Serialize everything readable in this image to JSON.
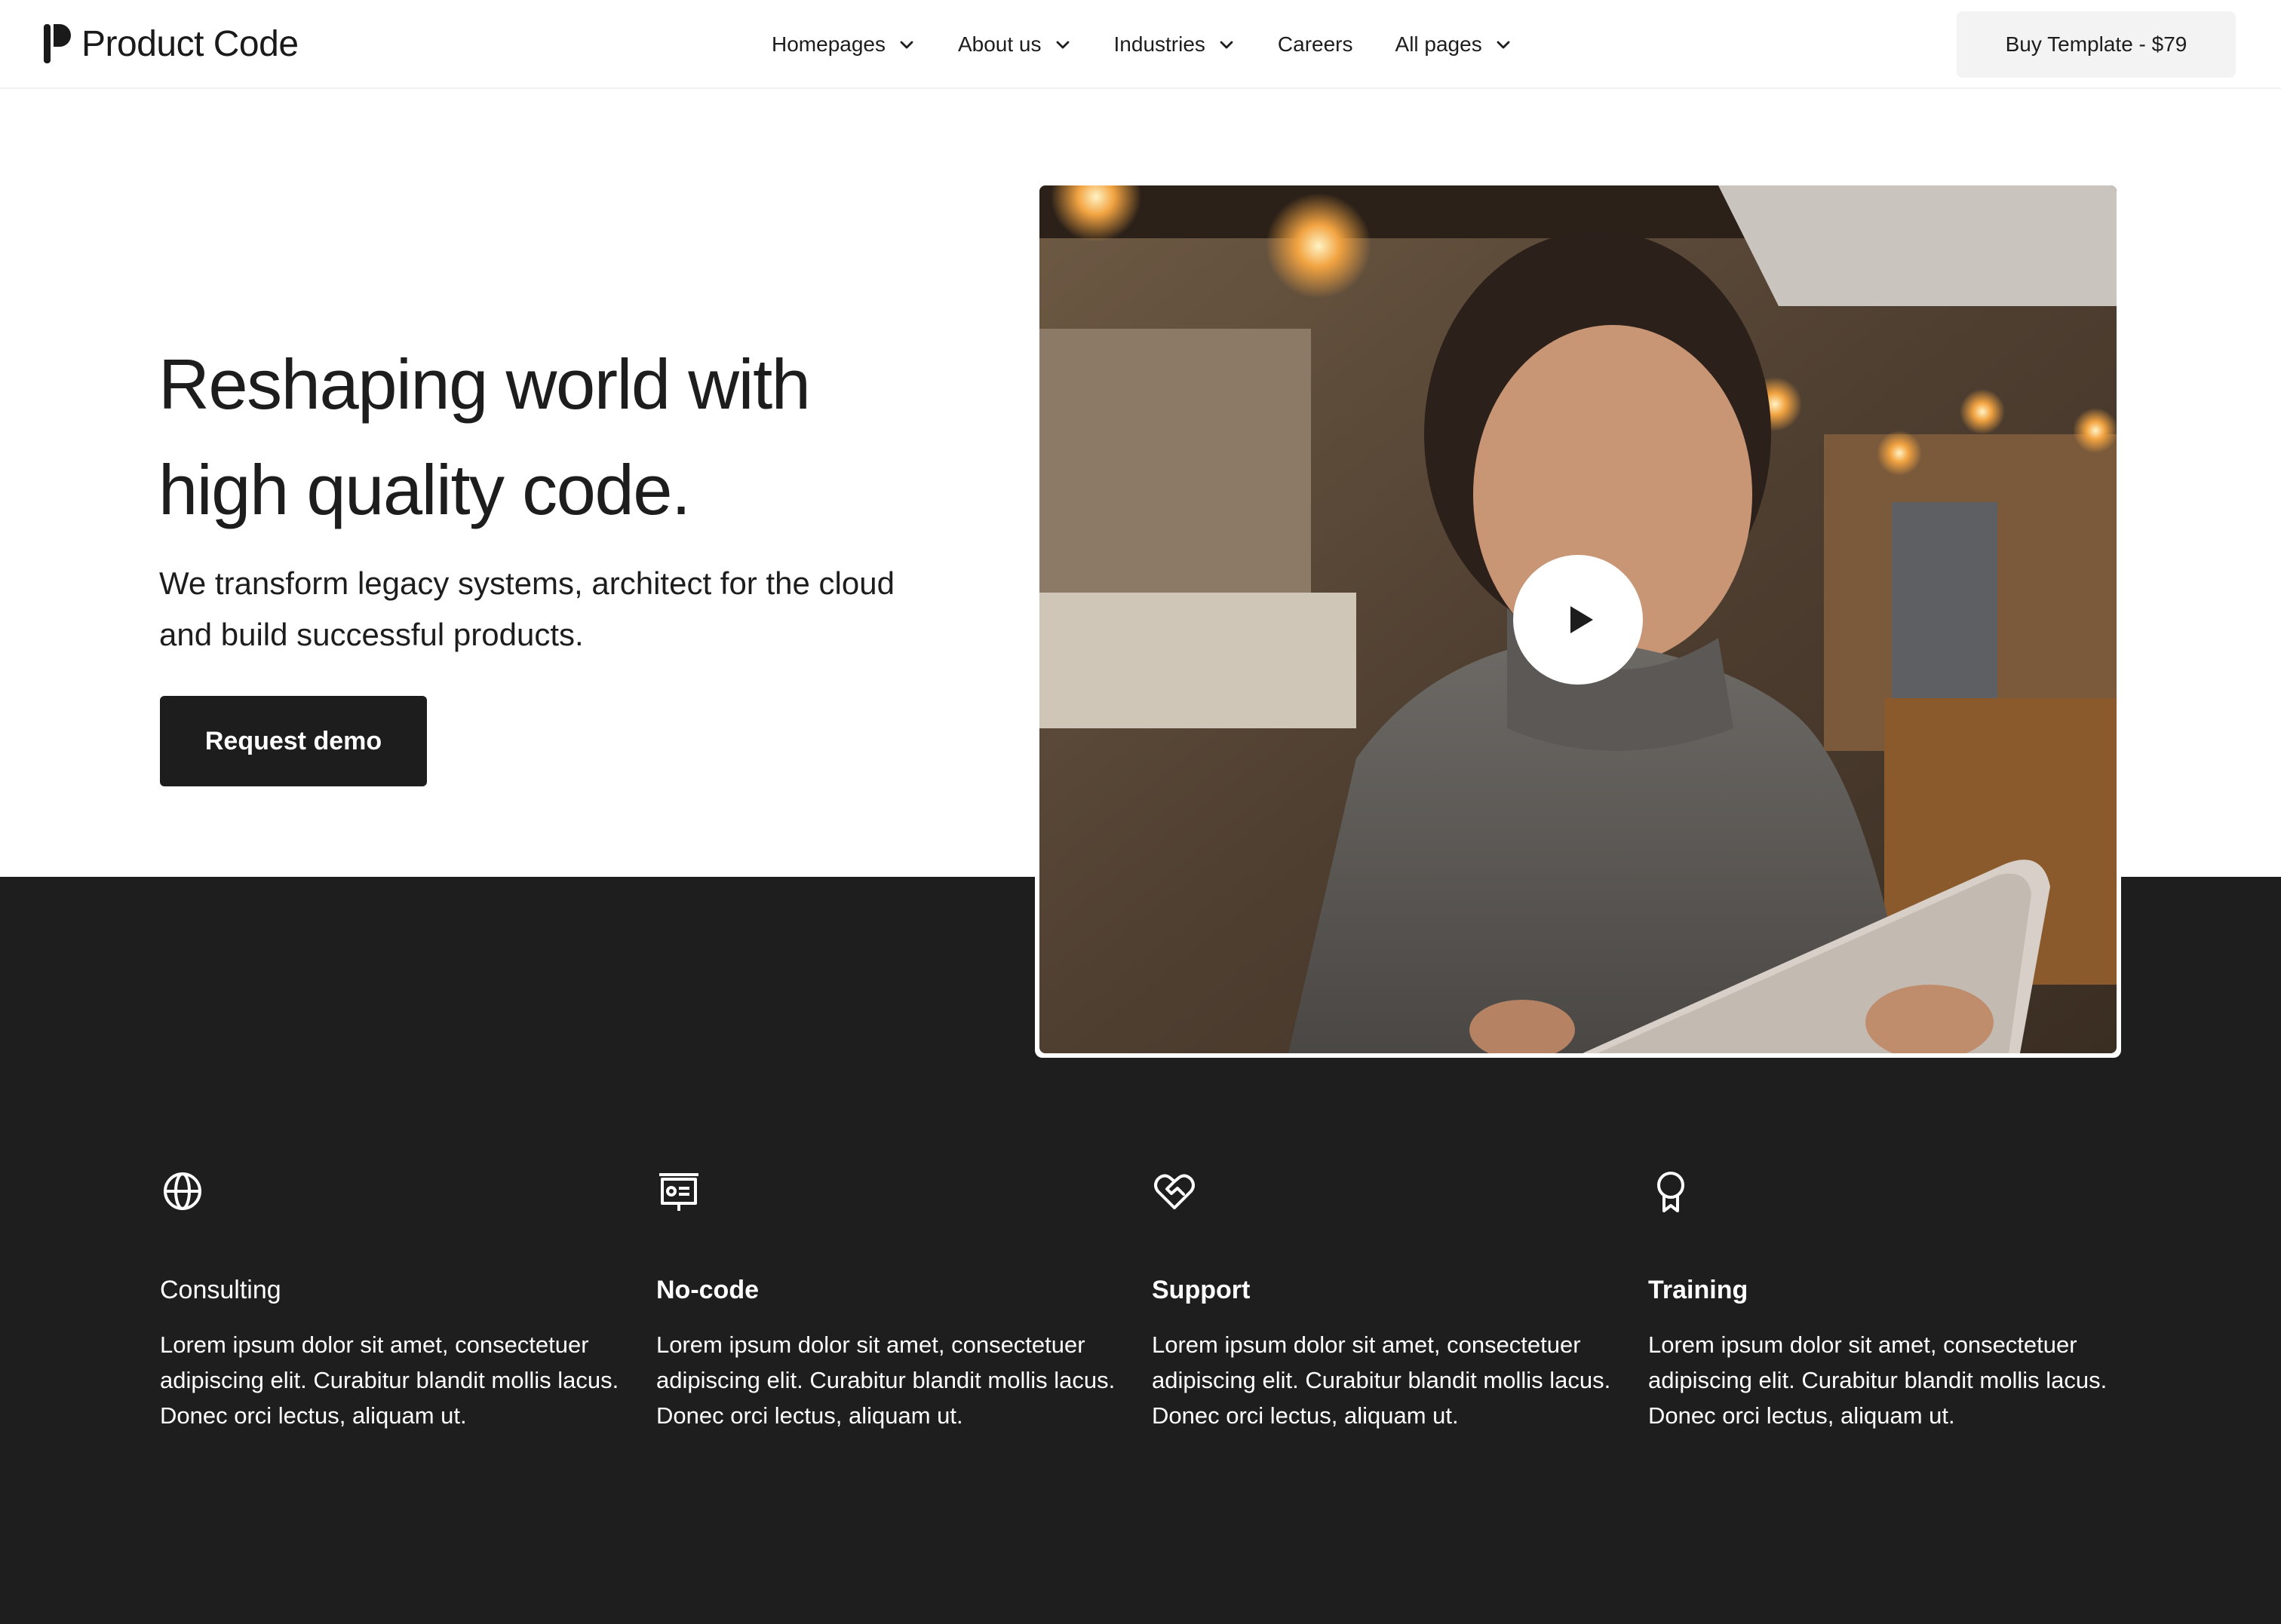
{
  "header": {
    "brand": "Product Code",
    "nav": [
      {
        "label": "Homepages",
        "has_dropdown": true
      },
      {
        "label": "About us",
        "has_dropdown": true
      },
      {
        "label": "Industries",
        "has_dropdown": true
      },
      {
        "label": "Careers",
        "has_dropdown": false
      },
      {
        "label": "All pages",
        "has_dropdown": true
      }
    ],
    "cta": "Buy Template - $79"
  },
  "hero": {
    "title_line1": "Reshaping world with",
    "title_line2": "high quality code.",
    "subtitle": "We transform legacy systems, architect for the cloud and build successful products.",
    "button": "Request demo",
    "video_icon": "play-icon"
  },
  "features": [
    {
      "icon": "globe-icon",
      "title": "Consulting",
      "description": "Lorem ipsum dolor sit amet, consectetuer adipiscing elit. Curabitur blandit mollis lacus. Donec orci lectus, aliquam ut."
    },
    {
      "icon": "presentation-icon",
      "title": "No-code",
      "description": "Lorem ipsum dolor sit amet, consectetuer adipiscing elit. Curabitur blandit mollis lacus. Donec orci lectus, aliquam ut."
    },
    {
      "icon": "heart-handshake-icon",
      "title": "Support",
      "description": "Lorem ipsum dolor sit amet, consectetuer adipiscing elit. Curabitur blandit mollis lacus. Donec orci lectus, aliquam ut."
    },
    {
      "icon": "award-icon",
      "title": "Training",
      "description": "Lorem ipsum dolor sit amet, consectetuer adipiscing elit. Curabitur blandit mollis lacus. Donec orci lectus, aliquam ut."
    }
  ],
  "colors": {
    "dark": "#1e1e1e",
    "button_dark": "#1d1d1d",
    "buy_button_bg": "#f3f3f3",
    "text": "#1d1d1d",
    "white": "#ffffff"
  }
}
